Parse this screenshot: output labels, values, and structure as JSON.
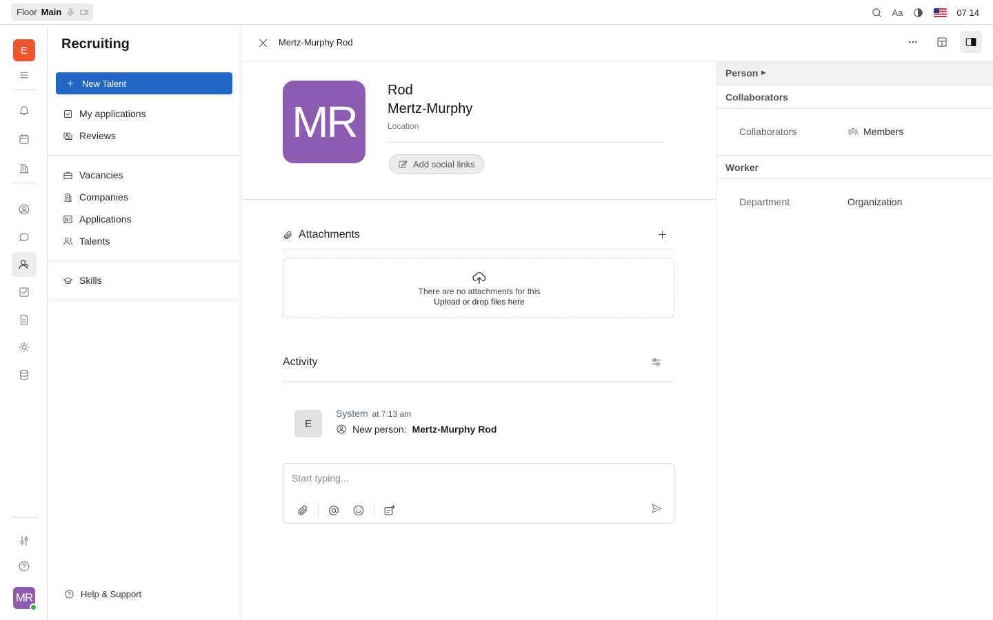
{
  "topbar": {
    "floor_label": "Floor",
    "main_label": "Main",
    "font_label": "Aa",
    "time": "07 14"
  },
  "rail": {
    "workspace_initial": "E",
    "user_initials": "MR"
  },
  "nav": {
    "title": "Recruiting",
    "new_button": "New Talent",
    "items_top": [
      {
        "label": "My applications",
        "icon": "checkbox-icon"
      },
      {
        "label": "Reviews",
        "icon": "reviews-icon"
      }
    ],
    "items_mid": [
      {
        "label": "Vacancies",
        "icon": "briefcase-icon"
      },
      {
        "label": "Companies",
        "icon": "building-icon"
      },
      {
        "label": "Applications",
        "icon": "application-card-icon"
      },
      {
        "label": "Talents",
        "icon": "people-icon"
      }
    ],
    "items_bottom": [
      {
        "label": "Skills",
        "icon": "graduation-cap-icon"
      }
    ],
    "help": "Help & Support"
  },
  "header": {
    "title": "Mertz-Murphy Rod"
  },
  "profile": {
    "initials": "MR",
    "first_name": "Rod",
    "last_name": "Mertz-Murphy",
    "location_placeholder": "Location",
    "social_button": "Add social links",
    "avatar_color": "#8e5bb3"
  },
  "attachments": {
    "title": "Attachments",
    "empty_text": "There are no attachments for this",
    "upload_text": "Upload or drop files here"
  },
  "activity": {
    "title": "Activity",
    "entries": [
      {
        "avatar": "E",
        "author": "System",
        "time": "at 7:13 am",
        "message_prefix": "New person:",
        "message_subject": "Mertz-Murphy Rod"
      }
    ],
    "composer_placeholder": "Start typing..."
  },
  "details": {
    "head_label": "Person",
    "collaborators_section": "Collaborators",
    "collaborators_label": "Collaborators",
    "collaborators_value": "Members",
    "worker_section": "Worker",
    "department_label": "Department",
    "department_value": "Organization"
  },
  "colors": {
    "accent": "#2267c8",
    "workspace_badge": "#f0542d",
    "online": "#32b24a"
  }
}
